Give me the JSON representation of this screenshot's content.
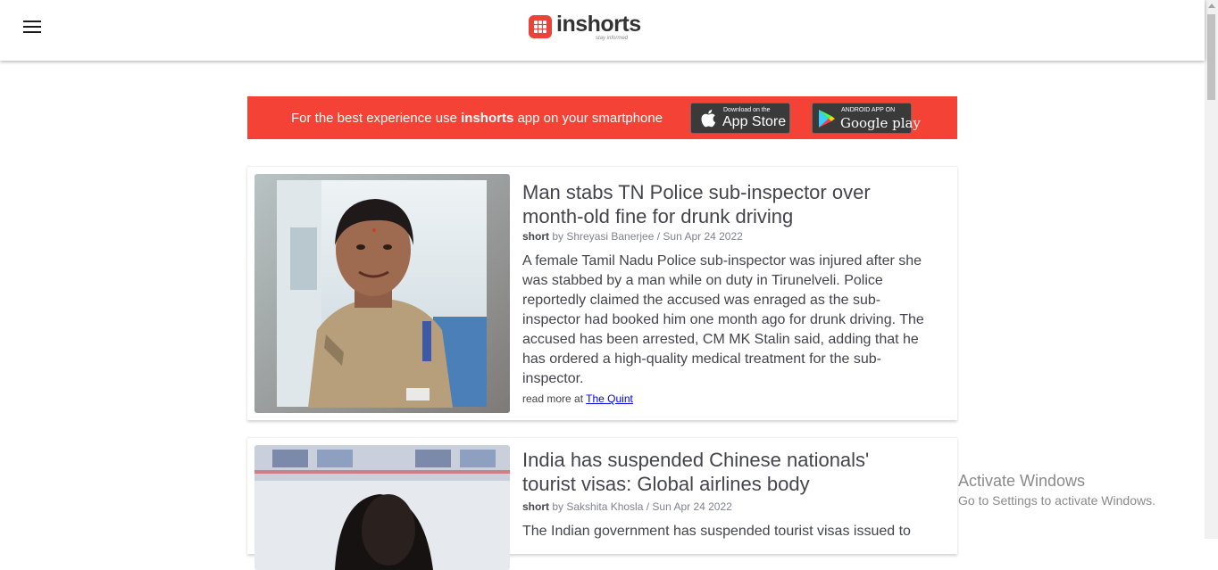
{
  "header": {
    "menu_icon": "hamburger-menu-icon",
    "logo_text": "inshorts",
    "logo_tagline": "stay informed",
    "brand_color": "#e8443a"
  },
  "banner": {
    "text_before": "For the best experience use ",
    "text_brand": "inshorts",
    "text_after": " app on your smartphone",
    "background_color": "#f44336",
    "app_store": {
      "small": "Download on the",
      "big": "App Store",
      "icon": "apple-icon"
    },
    "google_play": {
      "small": "ANDROID APP ON",
      "big": "Google play",
      "icon": "play-store-icon"
    }
  },
  "articles": [
    {
      "title": "Man stabs TN Police sub-inspector over month-old fine for drunk driving",
      "type": "short",
      "by": " by ",
      "author": "Shreyasi Banerjee",
      "separator": " / ",
      "date": "Sun Apr 24 2022",
      "body": "A female Tamil Nadu Police sub-inspector was injured after she was stabbed by a man while on duty in Tirunelveli. Police reportedly claimed the accused was enraged as the sub-inspector had booked him one month ago for drunk driving. The accused has been arrested, CM MK Stalin said, adding that he has ordered a high-quality medical treatment for the sub-inspector.",
      "read_more_label": "read more at ",
      "source": "The Quint"
    },
    {
      "title": "India has suspended Chinese nationals' tourist visas: Global airlines body",
      "type": "short",
      "by": " by ",
      "author": "Sakshita Khosla",
      "separator": " / ",
      "date": "Sun Apr 24 2022",
      "body": "The Indian government has suspended tourist visas issued to"
    }
  ],
  "watermark": {
    "line1": "Activate Windows",
    "line2": "Go to Settings to activate Windows."
  }
}
